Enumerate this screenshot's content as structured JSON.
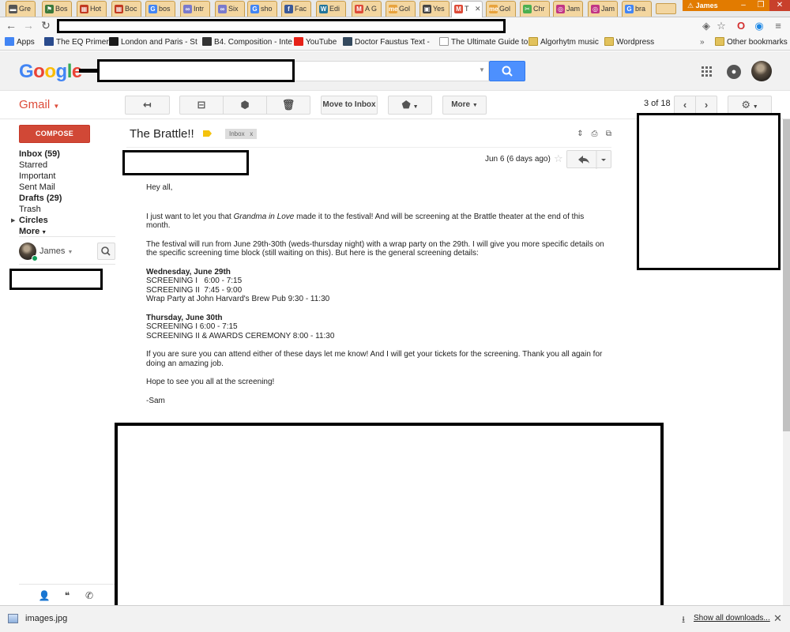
{
  "browser": {
    "tabs": [
      {
        "label": "Gre",
        "color": "#555555",
        "glyph": "▬"
      },
      {
        "label": "Bos",
        "color": "#3c7a3c",
        "glyph": "⚑"
      },
      {
        "label": "Hot",
        "color": "#c23b22",
        "glyph": "▦"
      },
      {
        "label": "Boc",
        "color": "#c23b22",
        "glyph": "▦"
      },
      {
        "label": "bos",
        "color": "#4285f4",
        "glyph": "G"
      },
      {
        "label": "Intr",
        "color": "#7a7acc",
        "glyph": "∞"
      },
      {
        "label": "Six",
        "color": "#7a7acc",
        "glyph": "∞"
      },
      {
        "label": "sho",
        "color": "#4285f4",
        "glyph": "G"
      },
      {
        "label": "Fac",
        "color": "#3b5998",
        "glyph": "f"
      },
      {
        "label": "Edi",
        "color": "#21759b",
        "glyph": "W"
      },
      {
        "label": "A G",
        "color": "#dd4b39",
        "glyph": "M"
      },
      {
        "label": "Gol",
        "color": "#e8a33d",
        "glyph": "me"
      },
      {
        "label": "Yes",
        "color": "#444444",
        "glyph": "▣"
      },
      {
        "label": "T",
        "color": "#dd4b39",
        "glyph": "M"
      },
      {
        "label": "Gol",
        "color": "#e8a33d",
        "glyph": "me"
      },
      {
        "label": "Chr",
        "color": "#4caf50",
        "glyph": "✂"
      },
      {
        "label": "Jam",
        "color": "#c13584",
        "glyph": "◎"
      },
      {
        "label": "Jam",
        "color": "#c13584",
        "glyph": "◎"
      },
      {
        "label": "bra",
        "color": "#4285f4",
        "glyph": "G"
      }
    ],
    "profile_name": "James",
    "bookmarks": [
      {
        "label": "Apps",
        "icon": "apps-grid-icon",
        "color": "#4285f4"
      },
      {
        "label": "The EQ Primer",
        "icon": "site-s-icon",
        "color": "#2a4b8d"
      },
      {
        "label": "London and Paris - St",
        "icon": "site-ef-icon",
        "color": "#1b1b1b"
      },
      {
        "label": "B4. Composition - Inte",
        "icon": "music-note-icon",
        "color": "#333333"
      },
      {
        "label": "YouTube",
        "icon": "youtube-icon",
        "color": "#e62117"
      },
      {
        "label": "Doctor Faustus Text -",
        "icon": "owl-icon",
        "color": "#34495e"
      },
      {
        "label": "The Ultimate Guide to",
        "icon": "page-icon",
        "color": "#ffffff"
      },
      {
        "label": "Algorhytm music",
        "icon": "folder-icon",
        "color": "#e2c25c"
      },
      {
        "label": "Wordpress",
        "icon": "folder-icon",
        "color": "#e2c25c"
      }
    ],
    "bookmarks_overflow": "»",
    "other_bookmarks": "Other bookmarks"
  },
  "gmail": {
    "logo": [
      "G",
      "o",
      "o",
      "g",
      "l",
      "e"
    ],
    "logo_colors": [
      "#4285f4",
      "#ea4335",
      "#fbbc05",
      "#4285f4",
      "#34a853",
      "#ea4335"
    ],
    "app_label": "Gmail",
    "toolbar": {
      "move_to_inbox": "Move to Inbox",
      "more": "More",
      "pager": "3 of 18"
    },
    "compose": "COMPOSE",
    "nav": [
      {
        "label": "Inbox (59)",
        "bold": true
      },
      {
        "label": "Starred",
        "bold": false
      },
      {
        "label": "Important",
        "bold": false
      },
      {
        "label": "Sent Mail",
        "bold": false
      },
      {
        "label": "Drafts (29)",
        "bold": true
      },
      {
        "label": "Trash",
        "bold": false
      },
      {
        "label": "Circles",
        "bold": true
      },
      {
        "label": "More",
        "bold": true
      }
    ],
    "chat_user": "James"
  },
  "message": {
    "subject": "The Brattle!!",
    "label_chip": "Inbox",
    "label_chip_close": "x",
    "date": "Jun 6 (6 days ago)",
    "greeting": "Hey all,",
    "p1_before": "I just want to let you that ",
    "p1_italic": "Grandma in Love",
    "p1_after": " made it to the festival! And will be screening at the Brattle theater at the end of this month.",
    "p2": "The festival will run from June 29th-30th (weds-thursday night) with a wrap party on the 29th. I will give you more specific details on the specific screening time block (still waiting on this).  But here is the general screening details:",
    "day1": {
      "heading": "Wednesday, June 29th",
      "lines": [
        "SCREENING I   6:00 - 7:15",
        "SCREENING II  7:45 - 9:00",
        "Wrap Party at John Harvard's Brew Pub 9:30 - 11:30"
      ]
    },
    "day2": {
      "heading": "Thursday, June 30th",
      "lines": [
        "SCREENING I 6:00 - 7:15",
        "SCREENING II & AWARDS CEREMONY 8:00 - 11:30"
      ]
    },
    "p3": "If you are sure you can attend either of these days let me know! And I will get your tickets for the screening. Thank you all again for doing an amazing job.",
    "p4": "Hope to see you all at the screening!",
    "signature": "-Sam"
  },
  "downloads": {
    "file": "images.jpg",
    "show_all": "Show all downloads..."
  }
}
